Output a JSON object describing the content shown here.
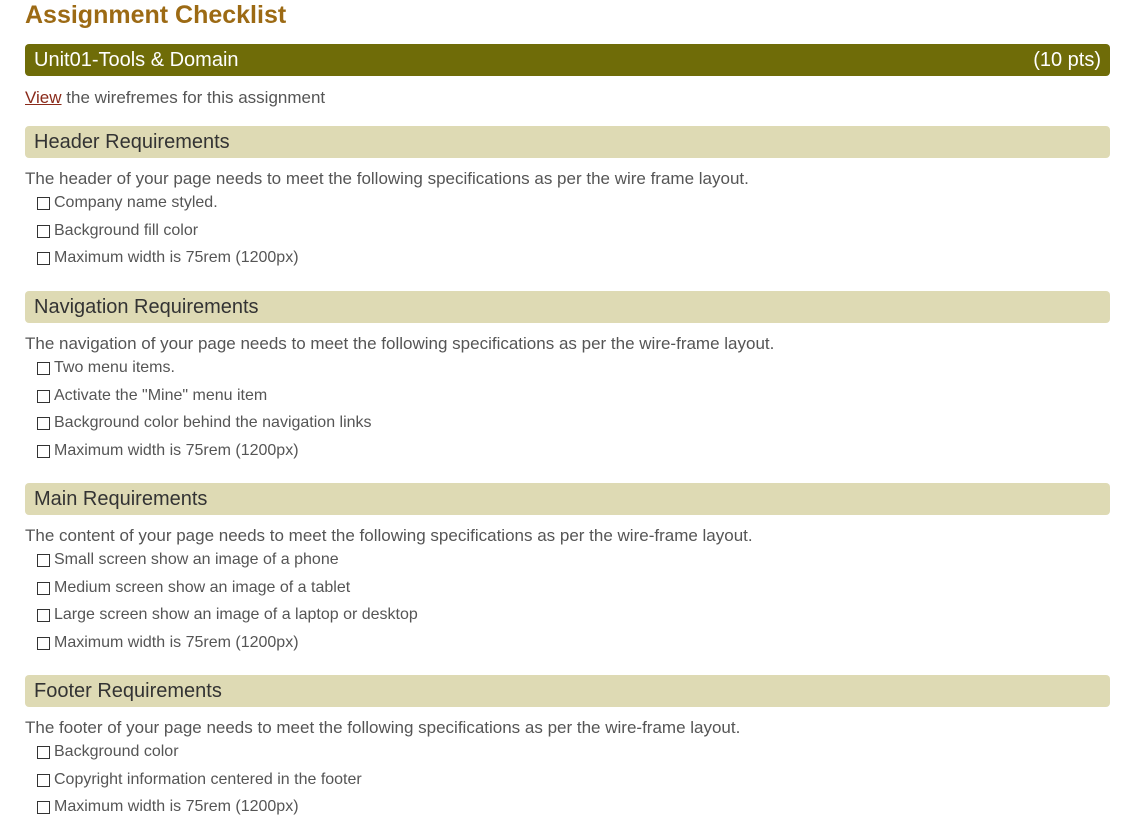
{
  "page_title": "Assignment Checklist",
  "unit": {
    "name": "Unit01-Tools & Domain",
    "points": "(10 pts)"
  },
  "view_line": {
    "link_text": "View",
    "rest": " the wirefremes for this assignment"
  },
  "sections": [
    {
      "title": "Header Requirements",
      "description": "The header of your page needs to meet the following specifications as per the wire frame layout.",
      "items": [
        "Company name styled.",
        "Background fill color",
        "Maximum width is 75rem (1200px)"
      ]
    },
    {
      "title": "Navigation Requirements",
      "description": "The navigation of your page needs to meet the following specifications as per the wire-frame layout.",
      "items": [
        "Two menu items.",
        "Activate the \"Mine\" menu item",
        "Background color behind the navigation links",
        "Maximum width is 75rem (1200px)"
      ]
    },
    {
      "title": "Main Requirements",
      "description": "The content of your page needs to meet the following specifications as per the wire-frame layout.",
      "items": [
        "Small screen show an image of a phone",
        "Medium screen show an image of a tablet",
        "Large screen show an image of a laptop or desktop",
        "Maximum width is 75rem (1200px)"
      ]
    },
    {
      "title": "Footer Requirements",
      "description": "The footer of your page needs to meet the following specifications as per the wire-frame layout.",
      "items": [
        "Background color",
        "Copyright information centered in the footer",
        "Maximum width is 75rem (1200px)"
      ]
    }
  ],
  "colors": {
    "title": "#9c6a14",
    "unit_bar": "#6f6c08",
    "section_bar": "#dedab4",
    "link": "#8a2a1a"
  }
}
